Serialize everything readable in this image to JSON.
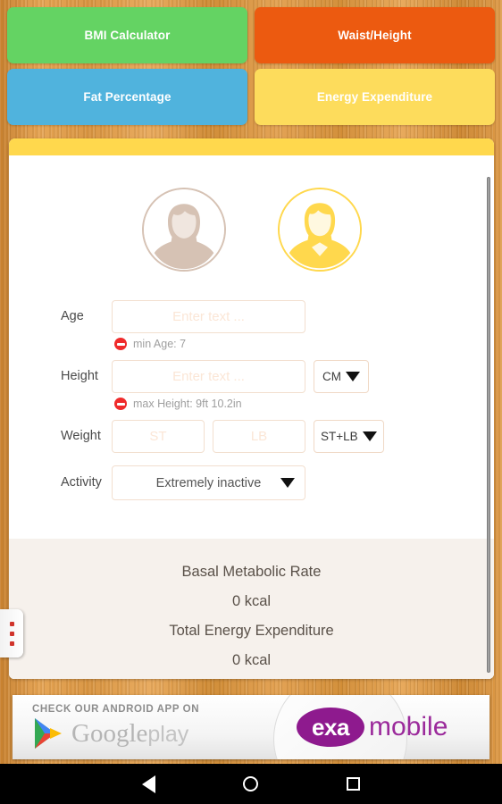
{
  "nav_buttons": [
    {
      "label": "BMI Calculator",
      "color": "#64d363"
    },
    {
      "label": "Waist/Height",
      "color": "#ec5a10"
    },
    {
      "label": "Fat Percentage",
      "color": "#50b3dd"
    },
    {
      "label": "Energy Expenditure",
      "color": "#fddc5c"
    }
  ],
  "gender": {
    "female_label": "female-avatar",
    "male_label": "male-avatar",
    "selected": "male",
    "female_color": "#d6c2b4",
    "male_color": "#ffd84d"
  },
  "form": {
    "age": {
      "label": "Age",
      "value": "",
      "placeholder": "Enter text ...",
      "error": "min Age: 7"
    },
    "height": {
      "label": "Height",
      "value": "",
      "placeholder": "Enter text ...",
      "error": "max Height: 9ft 10.2in",
      "unit": "CM"
    },
    "weight": {
      "label": "Weight",
      "stone_value": "",
      "stone_placeholder": "ST",
      "pound_value": "",
      "pound_placeholder": "LB",
      "unit": "ST+LB"
    },
    "activity": {
      "label": "Activity",
      "value": "Extremely inactive"
    }
  },
  "results": {
    "bmr_label": "Basal Metabolic Rate",
    "bmr_value": "0 kcal",
    "tee_label": "Total Energy Expenditure",
    "tee_value": "0 kcal"
  },
  "ad": {
    "kicker": "CHECK OUR ANDROID APP ON",
    "store_name": "Google",
    "store_suffix": "play",
    "brand_badge": "exa",
    "brand_name": "mobile"
  },
  "android_nav": {
    "back": "back-button",
    "home": "home-button",
    "recents": "recents-button"
  }
}
